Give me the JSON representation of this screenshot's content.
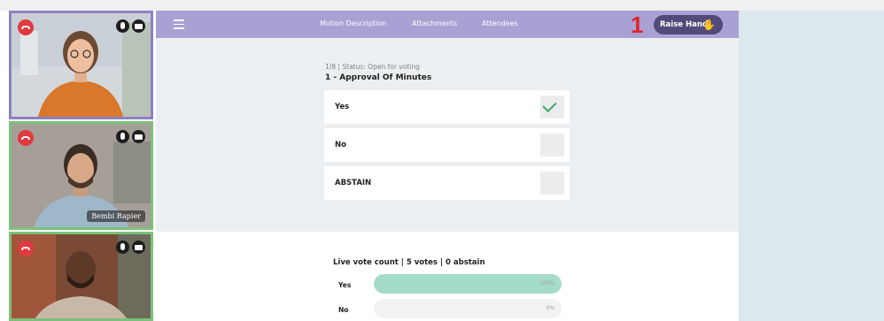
{
  "participants": [
    {
      "hangup": "hangup-icon",
      "mic": "microphone-icon",
      "camera": "camera-icon",
      "active": true
    },
    {
      "hangup": "hangup-icon",
      "mic": "microphone-icon",
      "camera": "camera-icon",
      "name": "Bembi Rapier"
    },
    {
      "hangup": "hangup-icon",
      "mic": "microphone-icon",
      "camera": "camera-icon"
    }
  ],
  "topbar": {
    "menu_icon": "hamburger-menu-icon",
    "links": [
      "Motion Description",
      "Attachments",
      "Attendees"
    ],
    "badge": "1",
    "raise_hand_label": "Raise Hand",
    "raise_hand_icon": "raised-hand-icon"
  },
  "motion": {
    "status": "1/8 | Status: Open for voting",
    "title": "1 - Approval Of Minutes",
    "options": [
      {
        "label": "Yes",
        "checked": true
      },
      {
        "label": "No",
        "checked": false
      },
      {
        "label": "ABSTAIN",
        "checked": false
      }
    ]
  },
  "live_votes": {
    "title": "Live vote count | 5 votes | 0 abstain",
    "rows": [
      {
        "label": "Yes",
        "percent": "100%",
        "fraction": 1.0
      },
      {
        "label": "No",
        "percent": "0%",
        "fraction": 0.0
      }
    ]
  },
  "colors": {
    "topbar": "#a9a1d3",
    "raise_hand_button": "#524a78",
    "badge": "#e0242a",
    "active_tile_border": "#8e80c2",
    "tile_border": "#7cc07c",
    "vote_fill": "#a4dcc8",
    "check": "#42a866",
    "hangup": "#e0393e"
  }
}
